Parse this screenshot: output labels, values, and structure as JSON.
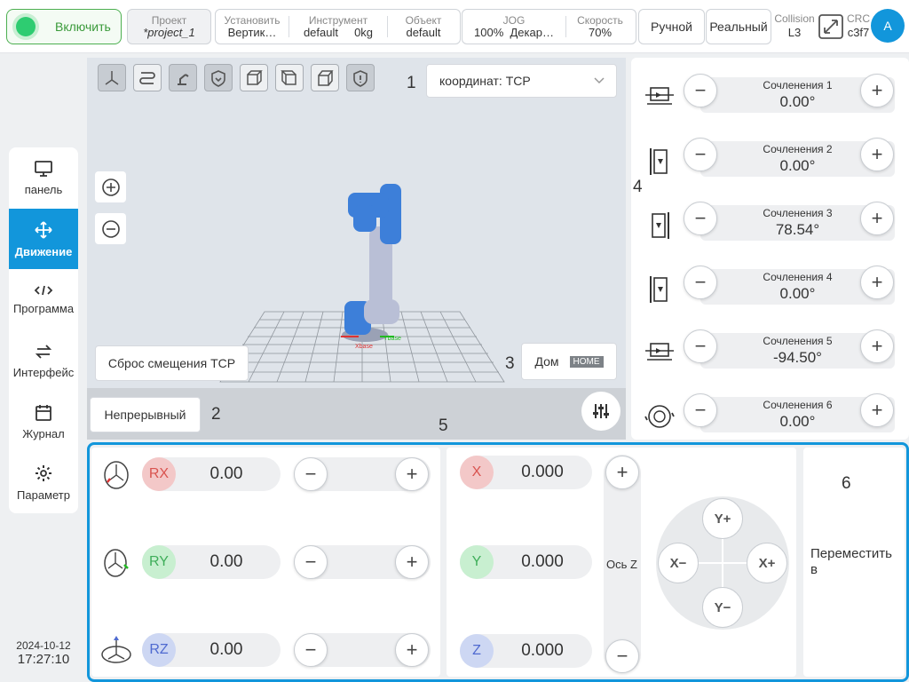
{
  "topbar": {
    "enable_label": "Включить",
    "project": {
      "title": "Проект",
      "value": "*project_1"
    },
    "install": {
      "title": "Установить",
      "value": "Вертик…"
    },
    "tool": {
      "title": "Инструмент",
      "value": "default",
      "mass": "0kg"
    },
    "object": {
      "title": "Объект",
      "value": "default"
    },
    "jog": {
      "title": "JOG",
      "value": "100%",
      "mode": "Декар…"
    },
    "speed": {
      "title": "Скорость",
      "value": "70%"
    },
    "manual_label": "Ручной",
    "real_label": "Реальный",
    "collision": {
      "title": "Collision",
      "value": "L3"
    },
    "crc": {
      "title": "CRC",
      "value": "c3f7"
    },
    "avatar": "A"
  },
  "nav": [
    {
      "label": "панель"
    },
    {
      "label": "Движение"
    },
    {
      "label": "Программа"
    },
    {
      "label": "Интерфейс"
    },
    {
      "label": "Журнал"
    },
    {
      "label": "Параметр"
    }
  ],
  "datetime": {
    "date": "2024-10-12",
    "time": "17:27:10"
  },
  "viewport": {
    "coord_select": "координат: TCP",
    "reset_tcp": "Сброс смещения TCP",
    "home_label": "Дом",
    "home_tag": "HOME",
    "continuous_label": "Непрерывный",
    "markers": [
      "1",
      "2",
      "3",
      "4",
      "5",
      "6"
    ],
    "axis_x_label": "Xbase",
    "axis_y_label": "Ybase"
  },
  "joints": [
    {
      "name": "Сочленения 1",
      "value": "0.00°"
    },
    {
      "name": "Сочленения 2",
      "value": "0.00°"
    },
    {
      "name": "Сочленения 3",
      "value": "78.54°"
    },
    {
      "name": "Сочленения 4",
      "value": "0.00°"
    },
    {
      "name": "Сочленения 5",
      "value": "-94.50°"
    },
    {
      "name": "Сочленения 6",
      "value": "0.00°"
    }
  ],
  "rotation": [
    {
      "axis": "RX",
      "value": "0.00",
      "color": "#f3c8c8",
      "text": "#d9534f"
    },
    {
      "axis": "RY",
      "value": "0.00",
      "color": "#c8efd0",
      "text": "#3fae5a"
    },
    {
      "axis": "RZ",
      "value": "0.00",
      "color": "#cdd7f3",
      "text": "#4f6ad0"
    }
  ],
  "translation": [
    {
      "axis": "X",
      "value": "0.000",
      "color": "#f3c8c8",
      "text": "#d9534f"
    },
    {
      "axis": "Y",
      "value": "0.000",
      "color": "#c8efd0",
      "text": "#3fae5a"
    },
    {
      "axis": "Z",
      "value": "0.000",
      "color": "#cdd7f3",
      "text": "#4f6ad0"
    }
  ],
  "z_axis_label": "Ось Z",
  "dpad": {
    "up": "Y+",
    "down": "Y−",
    "left": "X−",
    "right": "X+"
  },
  "move_to": "Переместить в",
  "colors": {
    "accent": "#1296db",
    "enable": "#2ecc71"
  }
}
